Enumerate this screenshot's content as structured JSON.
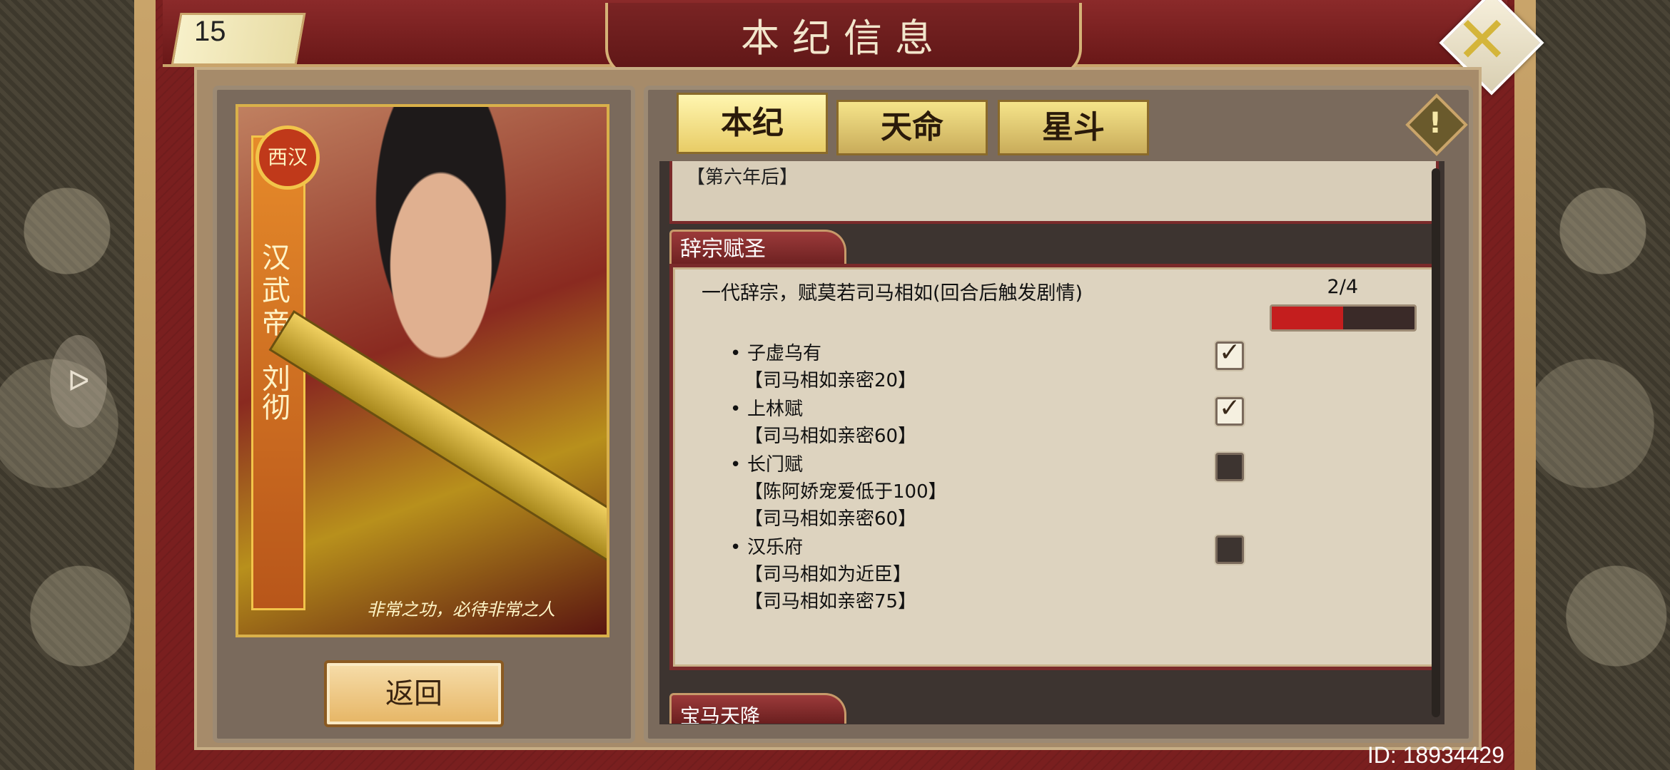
{
  "header": {
    "level": "15",
    "title": "本纪信息",
    "close_icon": "close-x-icon"
  },
  "portrait": {
    "seal_text": "西汉",
    "title_vertical": "汉武帝",
    "name_vertical": "刘彻",
    "motto": "非常之功，必待非常之人"
  },
  "back_button": {
    "label": "返回"
  },
  "tabs": [
    {
      "label": "本纪",
      "active": true
    },
    {
      "label": "天命",
      "active": false
    },
    {
      "label": "星斗",
      "active": false
    }
  ],
  "previous_card": {
    "text": "【第六年后】"
  },
  "section": {
    "name": "辞宗赋圣",
    "quest": {
      "description": "一代辞宗，赋莫若司马相如(回合后触发剧情)",
      "progress_text": "2/4",
      "progress_fraction": 0.5,
      "items": [
        {
          "name": "子虚乌有",
          "requirements": [
            "【司马相如亲密20】"
          ],
          "done": true
        },
        {
          "name": "上林赋",
          "requirements": [
            "【司马相如亲密60】"
          ],
          "done": true
        },
        {
          "name": "长门赋",
          "requirements": [
            "【陈阿娇宠爱低于100】",
            "【司马相如亲密60】"
          ],
          "done": false
        },
        {
          "name": "汉乐府",
          "requirements": [
            "【司马相如为近臣】",
            "【司马相如亲密75】"
          ],
          "done": false
        }
      ]
    }
  },
  "next_section": {
    "name": "宝马天降"
  },
  "footer": {
    "user_id": "ID: 18934429"
  },
  "colors": {
    "progress_fill": "#c41e1e",
    "frame_red": "#7a1f1f",
    "gold": "#c9a46a"
  }
}
